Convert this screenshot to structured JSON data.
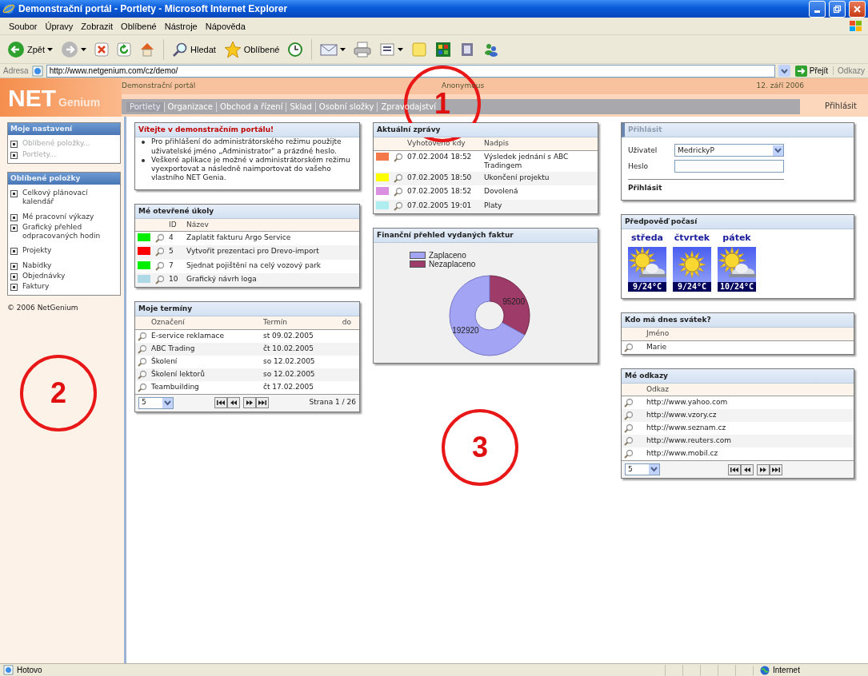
{
  "window": {
    "title": "Demonstrační portál - Portlety - Microsoft Internet Explorer"
  },
  "menu": [
    "Soubor",
    "Úpravy",
    "Zobrazit",
    "Oblíbené",
    "Nástroje",
    "Nápověda"
  ],
  "toolbar": {
    "back": "Zpět",
    "search": "Hledat",
    "favorites": "Oblíbené"
  },
  "address_bar": {
    "label": "Adresa",
    "url": "http://www.netgenium.com/cz/demo/",
    "go": "Přejít",
    "links": "Odkazy"
  },
  "portal": {
    "logo_main": "NET",
    "logo_sub": "Genium",
    "site": "Demonstrační portál",
    "user": "Anonymous",
    "date": "12. září 2006",
    "tabs": [
      {
        "label": "Portlety",
        "selected": true
      },
      {
        "label": "Organizace",
        "selected": false
      },
      {
        "label": "Obchod a řízení",
        "selected": false
      },
      {
        "label": "Sklad",
        "selected": false
      },
      {
        "label": "Osobní složky",
        "selected": false
      },
      {
        "label": "Zpravodajství",
        "selected": false
      }
    ],
    "login_link": "Přihlásit"
  },
  "sidebar": {
    "sections": [
      {
        "title": "Moje nastavení",
        "items": [
          {
            "label": "Oblíbené položky...",
            "disabled": true
          },
          {
            "label": "Portlety...",
            "disabled": true
          }
        ]
      },
      {
        "title": "Oblíbené položky",
        "items": [
          {
            "label": "Celkový plánovací kalendář",
            "disabled": false
          },
          {
            "label": "Mé pracovní výkazy",
            "disabled": false
          },
          {
            "label": "Grafický přehled odpracovaných hodin",
            "disabled": false
          },
          {
            "label": "Projekty",
            "disabled": false
          },
          {
            "label": "Nabídky",
            "disabled": false
          },
          {
            "label": "Objednávky",
            "disabled": false
          },
          {
            "label": "Faktury",
            "disabled": false
          }
        ]
      }
    ],
    "copyright": "© 2006 NetGenium"
  },
  "welcome": {
    "title": "Vítejte v demonstračním portálu!",
    "bullets": [
      "Pro přihlášení do administrátorského režimu použijte uživatelské jméno „Administrator\" a prázdné heslo.",
      "Veškeré aplikace je možné v administrátorském režimu vyexportovat a následně naimportovat do vašeho vlastního NET Genia."
    ]
  },
  "tasks": {
    "title": "Mé otevřené úkoly",
    "columns": [
      "ID",
      "Název"
    ],
    "rows": [
      {
        "color": "#00ee00",
        "id": "4",
        "name": "Zaplatit fakturu Argo Service"
      },
      {
        "color": "#ff0000",
        "id": "5",
        "name": "Vytvořit prezentaci pro Drevo-import"
      },
      {
        "color": "#00ee00",
        "id": "7",
        "name": "Sjednat pojištění na celý vozový park"
      },
      {
        "color": "#add8e6",
        "id": "10",
        "name": "Grafický návrh loga"
      }
    ]
  },
  "appointments": {
    "title": "Moje termíny",
    "columns": [
      "Označení",
      "Termín",
      "do"
    ],
    "rows": [
      {
        "name": "E-service reklamace",
        "date": "st 09.02.2005"
      },
      {
        "name": "ABC Trading",
        "date": "čt 10.02.2005"
      },
      {
        "name": "Školení",
        "date": "so 12.02.2005"
      },
      {
        "name": "Školení lektorů",
        "date": "so 12.02.2005"
      },
      {
        "name": "Teambuilding",
        "date": "čt 17.02.2005"
      }
    ],
    "page_size": "5",
    "page_info": "Strana 1 / 26"
  },
  "news": {
    "title": "Aktuální zprávy",
    "columns": [
      "Vyhotoveno kdy",
      "Nadpis"
    ],
    "rows": [
      {
        "color": "#f4794a",
        "date": "07.02.2004 18:52",
        "headline": "Výsledek jednání s ABC Tradingem"
      },
      {
        "color": "#ffff00",
        "date": "07.02.2005 18:50",
        "headline": "Ukončení projektu"
      },
      {
        "color": "#da8fe0",
        "date": "07.02.2005 18:52",
        "headline": "Dovolená"
      },
      {
        "color": "#aeeef0",
        "date": "07.02.2005 19:01",
        "headline": "Platy"
      }
    ]
  },
  "finance": {
    "title": "Finanční přehled vydaných faktur",
    "chart_data": {
      "type": "donut",
      "categories": [
        "Zaplaceno",
        "Nezaplaceno"
      ],
      "values": [
        192920,
        95200
      ],
      "data_labels": true,
      "legend": "top-left"
    }
  },
  "login": {
    "title": "Přihlásit",
    "user_label": "Uživatel",
    "user_value": "MedrickyP",
    "password_label": "Heslo",
    "submit": "Přihlásit"
  },
  "weather": {
    "title": "Předpověď počasí",
    "days": [
      {
        "day": "středa",
        "temp": "9/24°C",
        "kind": "partly-cloudy"
      },
      {
        "day": "čtvrtek",
        "temp": "9/24°C",
        "kind": "sunny"
      },
      {
        "day": "pátek",
        "temp": "10/24°C",
        "kind": "partly-cloudy"
      }
    ]
  },
  "nameday": {
    "title": "Kdo má dnes svátek?",
    "column": "Jméno",
    "rows": [
      "Marie"
    ]
  },
  "links": {
    "title": "Mé odkazy",
    "column": "Odkaz",
    "rows": [
      "http://www.yahoo.com",
      "http://www.vzory.cz",
      "http://www.seznam.cz",
      "http://www.reuters.com",
      "http://www.mobil.cz"
    ],
    "page_size": "5"
  },
  "status_bar": {
    "text": "Hotovo",
    "zone": "Internet"
  },
  "annotations": [
    {
      "label": "1"
    },
    {
      "label": "2"
    },
    {
      "label": "3"
    }
  ]
}
